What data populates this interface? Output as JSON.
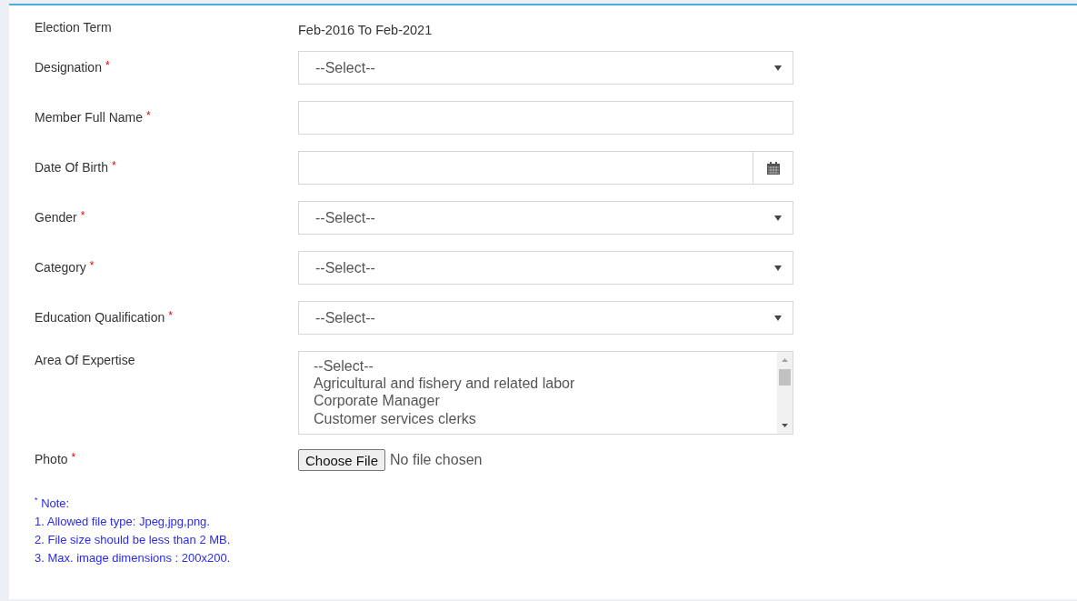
{
  "required_mark": "*",
  "election_term": {
    "label": "Election Term",
    "value": "Feb-2016 To Feb-2021"
  },
  "fields": [
    {
      "kind": "select",
      "label": "Designation",
      "required": true,
      "value": "--Select--"
    },
    {
      "kind": "text",
      "label": "Member Full Name",
      "required": true
    },
    {
      "kind": "date",
      "label": "Date Of Birth",
      "required": true
    },
    {
      "kind": "select",
      "label": "Gender",
      "required": true,
      "value": "--Select--"
    },
    {
      "kind": "select",
      "label": "Category",
      "required": true,
      "value": "--Select--"
    },
    {
      "kind": "select",
      "label": "Education Qualification",
      "required": true,
      "value": "--Select--"
    },
    {
      "kind": "listbox",
      "label": "Area Of Expertise",
      "required": false,
      "options": [
        "--Select--",
        "Agricultural and fishery and related labor",
        "Corporate Manager",
        "Customer services clerks"
      ]
    },
    {
      "kind": "file",
      "label": "Photo",
      "required": true,
      "button": "Choose File",
      "status": "No file chosen"
    }
  ],
  "notes": [
    "$^{*}$ Note:",
    "1. Allowed file type: Jpeg,jpg,png.",
    "2. File size should be less than 2 MB.",
    "3. Max. image dimensions : 200x200."
  ]
}
